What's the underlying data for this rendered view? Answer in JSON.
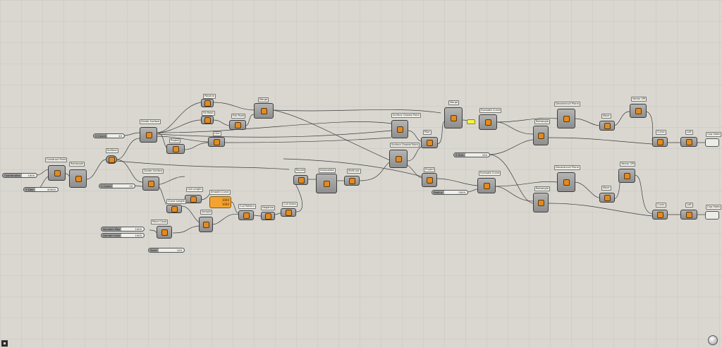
{
  "colors": {
    "canvas": "#d9d7d0",
    "wire": "#3d3d3d",
    "component": "#9c9c9c",
    "accent_orange": "#f3a430",
    "accent_yellow": "#f6f049"
  },
  "components": [
    "Construct Point",
    "Rectangle",
    "Divide Surface",
    "Surface",
    "Polyline",
    "Project",
    "Line",
    "Pipe",
    "Merge",
    "Fit Mesh",
    "Pull Point",
    "Surface Closest Point",
    "Curve",
    "Interpolate",
    "Shift List",
    "Smooth Curve",
    "Point Cloud",
    "Cull Pattern",
    "Evaluate Curve",
    "Loft",
    "Deconstruct Plane",
    "Move",
    "Vector 2Pt",
    "Cap Holes",
    "Curve Length",
    "Length",
    "List Length",
    "Merge Curve",
    "Multiply",
    "Sample",
    "Round",
    "Quad Remesh",
    "Cull Index",
    "Negative"
  ],
  "sliders": [
    {
      "name": "Coordinates",
      "value": "1000"
    },
    {
      "name": "Y Side",
      "value": "40000"
    },
    {
      "name": "U Count",
      "value": "40"
    },
    {
      "name": "V Count",
      "value": "10"
    },
    {
      "name": "Number Max",
      "value": "1000"
    },
    {
      "name": "Domain max",
      "value": "1000"
    },
    {
      "name": "Seed",
      "value": "100"
    },
    {
      "name": "Z Size",
      "value": "100"
    },
    {
      "name": "Radius",
      "value": "2000"
    }
  ],
  "panel_values": [
    "1000",
    "1000"
  ],
  "toolbar": {
    "corner_icon": "canvas-toggle-icon"
  }
}
